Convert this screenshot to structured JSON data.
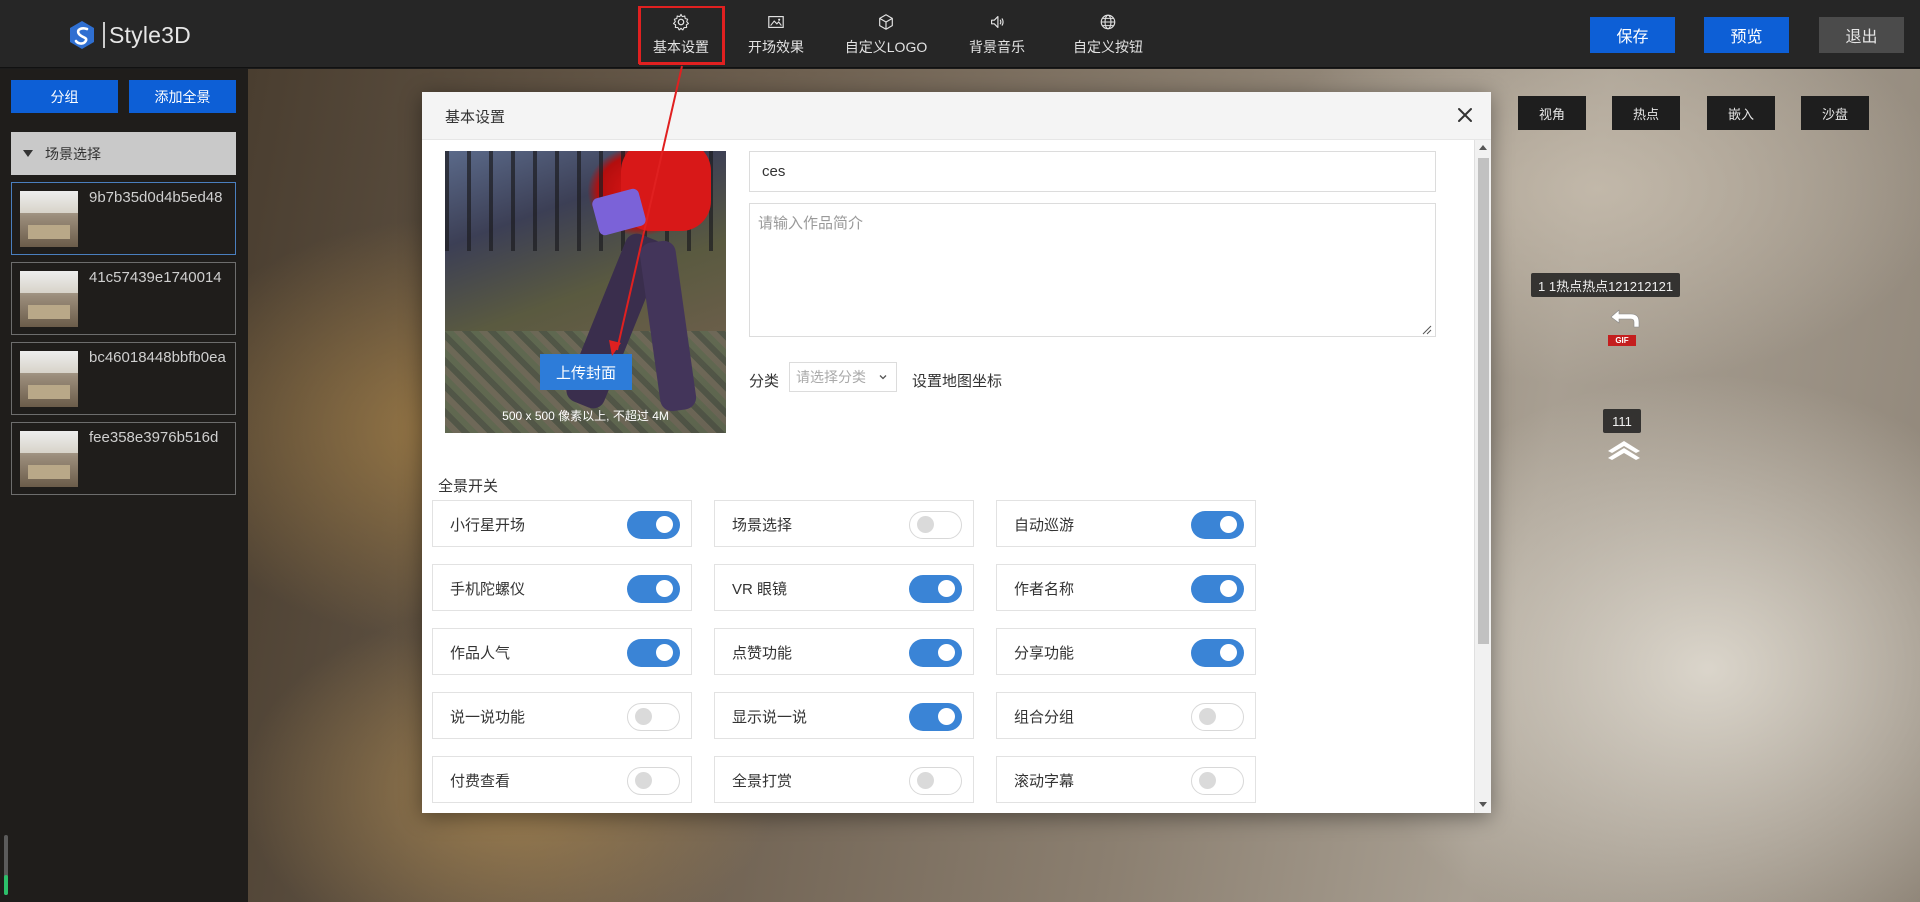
{
  "header": {
    "logo_text": "Style3D",
    "nav": [
      {
        "label": "基本设置",
        "icon": "gear-icon"
      },
      {
        "label": "开场效果",
        "icon": "image-icon"
      },
      {
        "label": "自定义LOGO",
        "icon": "cube-icon"
      },
      {
        "label": "背景音乐",
        "icon": "speaker-icon"
      },
      {
        "label": "自定义按钮",
        "icon": "globe-icon"
      }
    ],
    "save_label": "保存",
    "preview_label": "预览",
    "exit_label": "退出",
    "colors": {
      "primary": "#0d5fd6",
      "exit": "#4b4b4b",
      "annotation": "#e02020"
    }
  },
  "sidebar": {
    "group_label": "分组",
    "add_label": "添加全景",
    "scene_header": "场景选择",
    "scenes": [
      {
        "name": "9b7b35d0d4b5ed48"
      },
      {
        "name": "41c57439e1740014"
      },
      {
        "name": "bc46018448bbfb0ea"
      },
      {
        "name": "fee358e3976b516d"
      }
    ]
  },
  "pano": {
    "buttons": {
      "view": "视角",
      "hotspot": "热点",
      "embed": "嵌入",
      "sandbox": "沙盘"
    },
    "hotspot_label": "1 1热点热点121212121",
    "gif_badge": "GIF",
    "marker_label": "111"
  },
  "modal": {
    "title": "基本设置",
    "upload_label": "上传封面",
    "cover_hint": "500 x 500 像素以上, 不超过 4M",
    "title_value": "ces",
    "desc_placeholder": "请输入作品简介",
    "category_label": "分类",
    "category_placeholder": "请选择分类",
    "map_label": "设置地图坐标",
    "switch_section": "全景开关",
    "switches": [
      {
        "label": "小行星开场",
        "on": true
      },
      {
        "label": "场景选择",
        "on": false
      },
      {
        "label": "自动巡游",
        "on": true
      },
      {
        "label": "手机陀螺仪",
        "on": true
      },
      {
        "label": "VR 眼镜",
        "on": true
      },
      {
        "label": "作者名称",
        "on": true
      },
      {
        "label": "作品人气",
        "on": true
      },
      {
        "label": "点赞功能",
        "on": true
      },
      {
        "label": "分享功能",
        "on": true
      },
      {
        "label": "说一说功能",
        "on": false
      },
      {
        "label": "显示说一说",
        "on": true
      },
      {
        "label": "组合分组",
        "on": false
      },
      {
        "label": "付费查看",
        "on": false
      },
      {
        "label": "全景打赏",
        "on": false
      },
      {
        "label": "滚动字幕",
        "on": false
      }
    ]
  }
}
